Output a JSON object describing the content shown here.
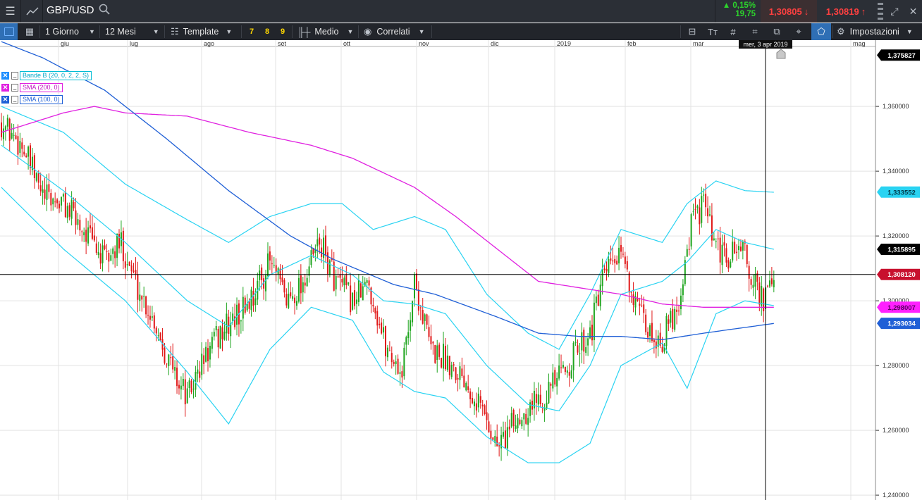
{
  "topbar": {
    "menu_icon": "hamburger-menu-icon",
    "chart_icon": "line-chart-icon",
    "symbol": "GBP/USD",
    "search_icon": "search-icon",
    "change_pct": "▲ 0,15%",
    "change_pts": "19,75",
    "bid": "1,30805",
    "ask": "1,30819",
    "bid_arrow": "↓",
    "ask_arrow": "↑",
    "price_color": "#ff4040"
  },
  "toolbar": {
    "period": "1 Giorno",
    "range": "12 Mesi",
    "template": "Template",
    "n7": "7",
    "n8": "8",
    "n9": "9",
    "indicator": "Medio",
    "correlati": "Correlati",
    "settings": "Impostazioni"
  },
  "legend": [
    {
      "label": "Bande B (20, 0, 2, 2, S)",
      "color": "#00bcd4"
    },
    {
      "label": "SMA (200, 0)",
      "color": "#e020e0"
    },
    {
      "label": "SMA (100, 0)",
      "color": "#1f5fd6"
    }
  ],
  "crosshair": {
    "date_label": "mer, 3 apr 2019",
    "price_label": "1,308120",
    "price_value": 1.30812
  },
  "chart_data": {
    "type": "candlestick",
    "title": "GBP/USD",
    "x_months": [
      "giu",
      "lug",
      "ago",
      "set",
      "ott",
      "nov",
      "dic",
      "2019",
      "feb",
      "mar",
      "mag"
    ],
    "y_ticks": [
      "1,360000",
      "1,340000",
      "1,320000",
      "1,300000",
      "1,280000",
      "1,260000",
      "1,240000"
    ],
    "ylim": [
      1.2385,
      1.3785
    ],
    "grid": true,
    "price_labels": [
      {
        "label": "1,375827",
        "value": 1.375827,
        "bg": "#000000",
        "fg": "#ffffff"
      },
      {
        "label": "1,333552",
        "value": 1.333552,
        "bg": "#29d3f2",
        "fg": "#003a4a"
      },
      {
        "label": "1,315895",
        "value": 1.315895,
        "bg": "#000000",
        "fg": "#ffffff"
      },
      {
        "label": "1,308120",
        "value": 1.30812,
        "bg": "#c8102e",
        "fg": "#ffffff"
      },
      {
        "label": "1,298007",
        "value": 1.298007,
        "bg": "#ff20ff",
        "fg": "#5a0060"
      },
      {
        "label": "1,293034",
        "value": 1.293034,
        "bg": "#1f5fd6",
        "fg": "#ffffff"
      }
    ],
    "close_waypoints": [
      [
        0,
        1.355
      ],
      [
        10,
        1.348
      ],
      [
        20,
        1.332
      ],
      [
        30,
        1.33
      ],
      [
        40,
        1.322
      ],
      [
        50,
        1.312
      ],
      [
        58,
        1.318
      ],
      [
        66,
        1.304
      ],
      [
        74,
        1.294
      ],
      [
        82,
        1.28
      ],
      [
        90,
        1.27
      ],
      [
        98,
        1.282
      ],
      [
        106,
        1.29
      ],
      [
        114,
        1.295
      ],
      [
        122,
        1.302
      ],
      [
        130,
        1.312
      ],
      [
        138,
        1.3
      ],
      [
        146,
        1.306
      ],
      [
        154,
        1.318
      ],
      [
        162,
        1.306
      ],
      [
        170,
        1.3
      ],
      [
        178,
        1.305
      ],
      [
        186,
        1.286
      ],
      [
        194,
        1.278
      ],
      [
        200,
        1.306
      ],
      [
        208,
        1.285
      ],
      [
        216,
        1.282
      ],
      [
        224,
        1.277
      ],
      [
        232,
        1.268
      ],
      [
        240,
        1.255
      ],
      [
        248,
        1.262
      ],
      [
        256,
        1.268
      ],
      [
        264,
        1.272
      ],
      [
        270,
        1.276
      ],
      [
        278,
        1.284
      ],
      [
        286,
        1.292
      ],
      [
        290,
        1.304
      ],
      [
        296,
        1.312
      ],
      [
        302,
        1.312
      ],
      [
        308,
        1.296
      ],
      [
        314,
        1.29
      ],
      [
        320,
        1.288
      ],
      [
        328,
        1.3
      ],
      [
        334,
        1.324
      ],
      [
        340,
        1.33
      ],
      [
        346,
        1.315
      ],
      [
        352,
        1.313
      ],
      [
        358,
        1.318
      ],
      [
        364,
        1.305
      ],
      [
        370,
        1.3
      ],
      [
        374,
        1.3081
      ]
    ],
    "bollinger_upper": [
      [
        0,
        1.36
      ],
      [
        30,
        1.352
      ],
      [
        60,
        1.336
      ],
      [
        90,
        1.325
      ],
      [
        110,
        1.318
      ],
      [
        130,
        1.326
      ],
      [
        150,
        1.33
      ],
      [
        165,
        1.33
      ],
      [
        180,
        1.322
      ],
      [
        200,
        1.326
      ],
      [
        215,
        1.322
      ],
      [
        235,
        1.302
      ],
      [
        255,
        1.29
      ],
      [
        270,
        1.285
      ],
      [
        285,
        1.302
      ],
      [
        300,
        1.322
      ],
      [
        320,
        1.318
      ],
      [
        332,
        1.33
      ],
      [
        346,
        1.337
      ],
      [
        360,
        1.334
      ],
      [
        374,
        1.3335
      ]
    ],
    "bollinger_middle": [
      [
        0,
        1.348
      ],
      [
        30,
        1.334
      ],
      [
        60,
        1.318
      ],
      [
        90,
        1.3
      ],
      [
        110,
        1.292
      ],
      [
        130,
        1.308
      ],
      [
        150,
        1.314
      ],
      [
        170,
        1.308
      ],
      [
        185,
        1.3
      ],
      [
        200,
        1.299
      ],
      [
        215,
        1.296
      ],
      [
        235,
        1.28
      ],
      [
        255,
        1.268
      ],
      [
        270,
        1.266
      ],
      [
        285,
        1.28
      ],
      [
        300,
        1.302
      ],
      [
        320,
        1.306
      ],
      [
        332,
        1.312
      ],
      [
        346,
        1.322
      ],
      [
        360,
        1.318
      ],
      [
        374,
        1.3159
      ]
    ],
    "bollinger_lower": [
      [
        0,
        1.335
      ],
      [
        30,
        1.316
      ],
      [
        60,
        1.3
      ],
      [
        90,
        1.278
      ],
      [
        110,
        1.262
      ],
      [
        130,
        1.285
      ],
      [
        150,
        1.298
      ],
      [
        170,
        1.294
      ],
      [
        185,
        1.278
      ],
      [
        200,
        1.272
      ],
      [
        215,
        1.27
      ],
      [
        235,
        1.258
      ],
      [
        255,
        1.25
      ],
      [
        270,
        1.25
      ],
      [
        285,
        1.256
      ],
      [
        300,
        1.28
      ],
      [
        320,
        1.287
      ],
      [
        332,
        1.273
      ],
      [
        346,
        1.296
      ],
      [
        360,
        1.3
      ],
      [
        374,
        1.2985
      ]
    ],
    "sma200": [
      [
        0,
        1.352
      ],
      [
        30,
        1.358
      ],
      [
        45,
        1.36
      ],
      [
        60,
        1.358
      ],
      [
        90,
        1.357
      ],
      [
        120,
        1.352
      ],
      [
        150,
        1.348
      ],
      [
        170,
        1.344
      ],
      [
        200,
        1.335
      ],
      [
        220,
        1.326
      ],
      [
        240,
        1.316
      ],
      [
        260,
        1.306
      ],
      [
        280,
        1.304
      ],
      [
        300,
        1.302
      ],
      [
        320,
        1.299
      ],
      [
        340,
        1.298
      ],
      [
        374,
        1.298
      ]
    ],
    "sma100": [
      [
        0,
        1.38
      ],
      [
        20,
        1.375
      ],
      [
        50,
        1.365
      ],
      [
        80,
        1.35
      ],
      [
        110,
        1.334
      ],
      [
        140,
        1.32
      ],
      [
        160,
        1.313
      ],
      [
        190,
        1.305
      ],
      [
        210,
        1.302
      ],
      [
        240,
        1.295
      ],
      [
        260,
        1.29
      ],
      [
        280,
        1.289
      ],
      [
        300,
        1.289
      ],
      [
        320,
        1.288
      ],
      [
        340,
        1.29
      ],
      [
        374,
        1.293
      ]
    ]
  }
}
